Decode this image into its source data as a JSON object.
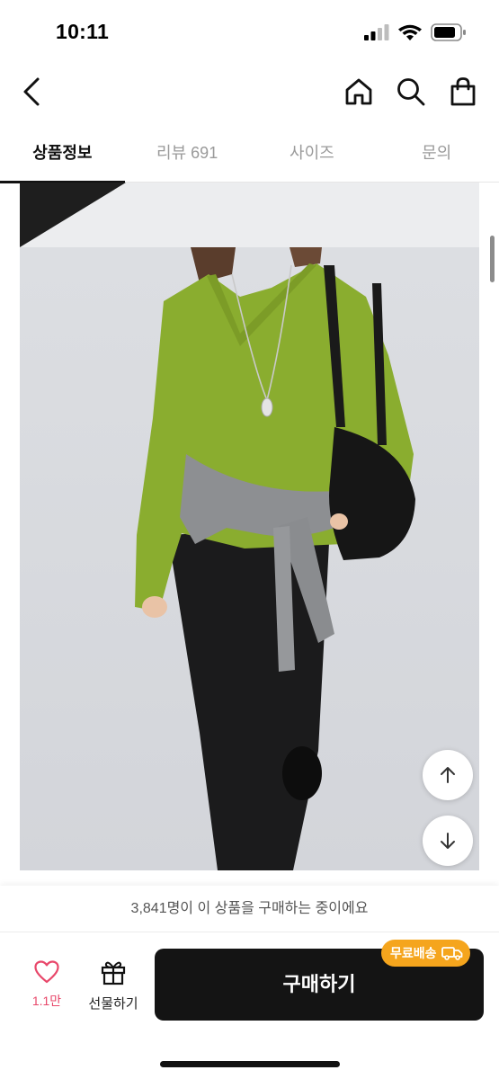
{
  "status_bar": {
    "time": "10:11"
  },
  "tabs": [
    {
      "label": "상품정보",
      "active": true
    },
    {
      "label": "리뷰 691",
      "active": false
    },
    {
      "label": "사이즈",
      "active": false
    },
    {
      "label": "문의",
      "active": false
    }
  ],
  "bottom": {
    "buyer_note": "3,841명이 이 상품을 구매하는 중이에요",
    "like_count": "1.1만",
    "gift_label": "선물하기",
    "buy_label": "구매하기",
    "free_shipping_badge": "무료배송"
  },
  "colors": {
    "accent_like": "#e8476a",
    "free_shipping": "#f5a51d",
    "buy_button": "#141414"
  }
}
